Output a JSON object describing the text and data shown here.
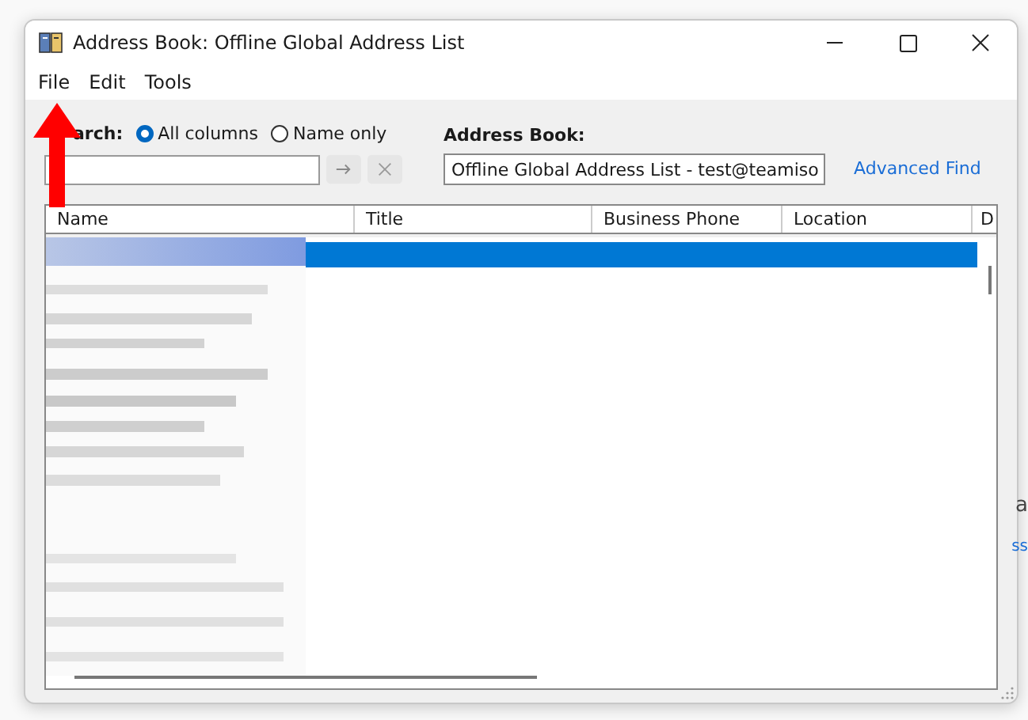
{
  "window": {
    "title": "Address Book: Offline Global Address List"
  },
  "menu": [
    {
      "label": "File"
    },
    {
      "label": "Edit"
    },
    {
      "label": "Tools"
    }
  ],
  "search": {
    "label": "arch:",
    "options": [
      {
        "label": "All columns",
        "selected": true
      },
      {
        "label": "Name only",
        "selected": false
      }
    ]
  },
  "address_book": {
    "label": "Address Book:",
    "value": "Offline Global Address List - test@teamiso"
  },
  "advanced_find": "Advanced Find",
  "table": {
    "columns": [
      "Name",
      "Title",
      "Business Phone",
      "Location",
      "D"
    ],
    "rows": [
      {
        "selected": true
      }
    ]
  },
  "background_fragments": [
    "a",
    "ss"
  ]
}
